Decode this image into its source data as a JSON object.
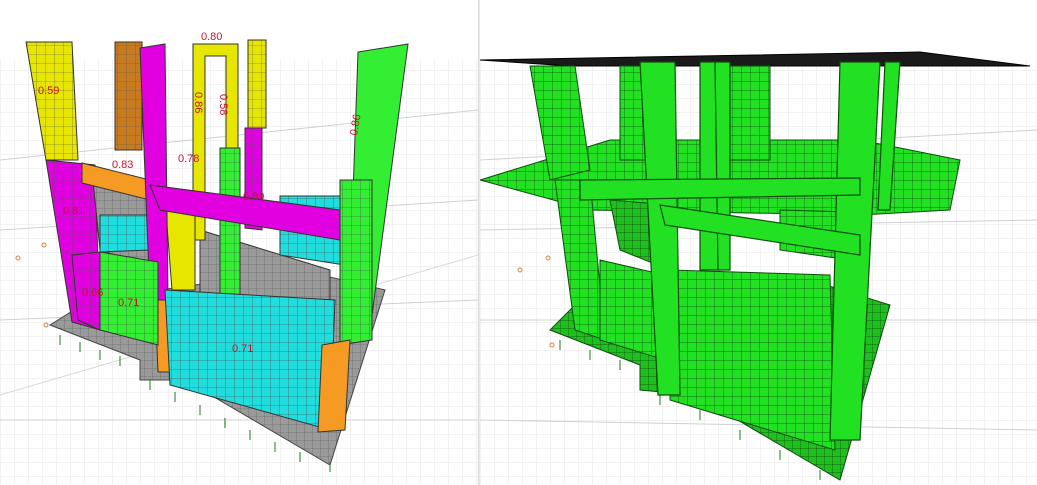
{
  "left_viewport": {
    "mode": "stress-ratio",
    "ratio_labels": [
      {
        "id": "top-col",
        "text": "0.80"
      },
      {
        "id": "c1",
        "text": "0.59"
      },
      {
        "id": "c2",
        "text": "0.86"
      },
      {
        "id": "c3",
        "text": "0.58"
      },
      {
        "id": "c4",
        "text": "0.83"
      },
      {
        "id": "c5",
        "text": "0.78"
      },
      {
        "id": "c6",
        "text": "0.89"
      },
      {
        "id": "c7",
        "text": "0.81"
      },
      {
        "id": "c8",
        "text": "0.86"
      },
      {
        "id": "c9",
        "text": "0.66"
      },
      {
        "id": "c10",
        "text": "0.71"
      },
      {
        "id": "c11",
        "text": "0.71"
      }
    ],
    "colors": {
      "yellow": "#e6e600",
      "magenta": "#e000e0",
      "green": "#33ee33",
      "cyan": "#22dddd",
      "orange": "#f59a23",
      "brown": "#c87a1e",
      "mesh": "#7a7a7a"
    }
  },
  "right_viewport": {
    "mode": "deformed-shape",
    "colors": {
      "green": "#22e022",
      "slab": "#1a1a1a",
      "mesh": "#0a4d0a"
    }
  }
}
